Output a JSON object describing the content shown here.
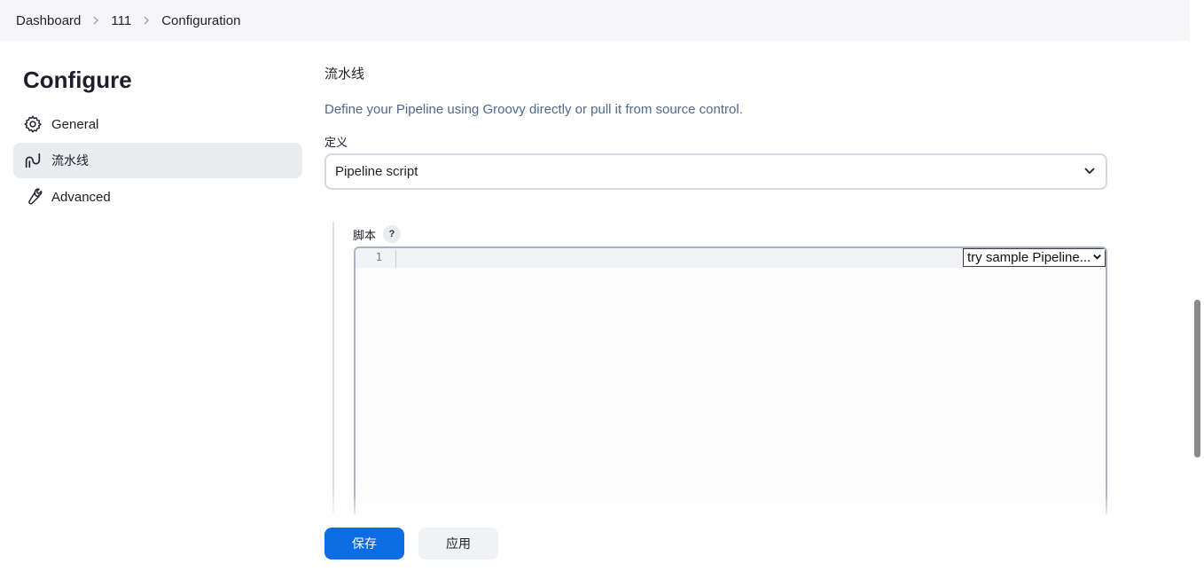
{
  "breadcrumb": {
    "items": [
      "Dashboard",
      "111",
      "Configuration"
    ]
  },
  "sidebar": {
    "title": "Configure",
    "items": [
      {
        "label": "General",
        "icon": "gear-icon",
        "active": false
      },
      {
        "label": "流水线",
        "icon": "pipeline-icon",
        "active": true
      },
      {
        "label": "Advanced",
        "icon": "wrench-icon",
        "active": false
      }
    ]
  },
  "main": {
    "section_title": "流水线",
    "section_desc": "Define your Pipeline using Groovy directly or pull it from source control.",
    "definition_label": "定义",
    "definition_value": "Pipeline script",
    "script_label": "脚本",
    "help": "?",
    "editor": {
      "line_numbers": [
        "1"
      ],
      "sample_select": "try sample Pipeline..."
    }
  },
  "actions": {
    "save_label": "保存",
    "apply_label": "应用"
  },
  "colors": {
    "primary": "#0b6ce3",
    "description": "#4d6a8c",
    "active_bg": "#ebecf0"
  }
}
